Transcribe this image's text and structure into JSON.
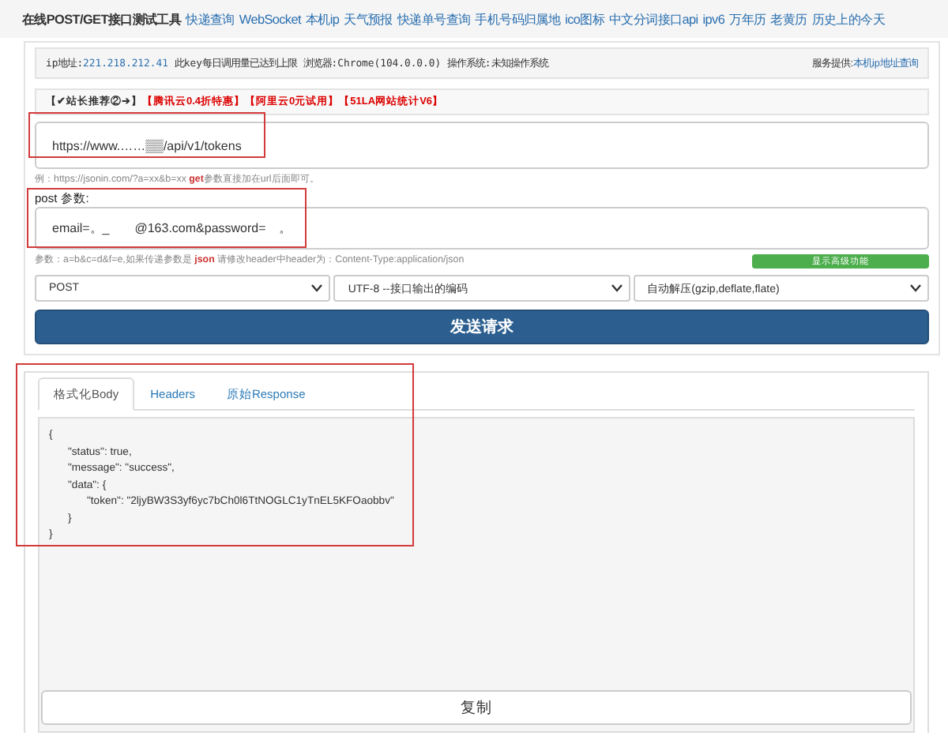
{
  "header": {
    "title": "在线POST/GET接口测试工具",
    "links": [
      "快递查询",
      "WebSocket",
      "本机ip",
      "天气预报",
      "快递单号查询",
      "手机号码归属地",
      "ico图标",
      "中文分词接口api",
      "ipv6",
      "万年历",
      "老黄历",
      "历史上的今天"
    ]
  },
  "info_bar": {
    "ip_label": "ip地址:",
    "ip": "221.218.212.41",
    "message": "此key每日调用量已达到上限 浏览器:Chrome(104.0.0.0) 操作系统:未知操作系统",
    "provider_label": "服务提供:",
    "provider_link": "本机ip地址查询"
  },
  "promo": [
    {
      "text": "【✔站长推荐②➔】",
      "highlight": false
    },
    {
      "text": "【腾讯云0.4折特惠】",
      "highlight": true
    },
    {
      "text": "【阿里云0元试用】",
      "highlight": true
    },
    {
      "text": "【51LA网站统计V6】",
      "highlight": true
    }
  ],
  "url_field": {
    "value": "https://www.……▒▒/api/v1/tokens",
    "hint": "例：https://jsonin.com/?a=xx&b=xx **get**参数直接加在url后面即可。"
  },
  "post_params": {
    "label": "post 参数:",
    "value": "email=。_　　@163.com&password=　。",
    "hint": "参数：a=b&c=d&f=e,如果传递参数是 **json** 请修改header中header为：Content-Type:application/json",
    "advanced_button": "显示高级功能"
  },
  "selects": [
    "POST",
    "UTF-8 --接口输出的编码",
    "自动解压(gzip,deflate,flate)"
  ],
  "send_button": "发送请求",
  "tabs": [
    {
      "label": "格式化Body",
      "selected": true
    },
    {
      "label": "Headers",
      "selected": false
    },
    {
      "label": "原始Response",
      "selected": false
    }
  ],
  "response_body": [
    {
      "open": "{",
      "close": "}",
      "children": [
        {
          "text": "\"status\": true,"
        },
        {
          "text": "\"message\": \"success\","
        },
        {
          "open": "\"data\": {",
          "close": "}",
          "children": [
            {
              "text": "\"token\": \"2ljyBW3S3yf6yc7bCh0l6TtNOGLC1yTnEL5KFOaobbv\""
            }
          ]
        }
      ]
    }
  ],
  "copy_button": "复制"
}
